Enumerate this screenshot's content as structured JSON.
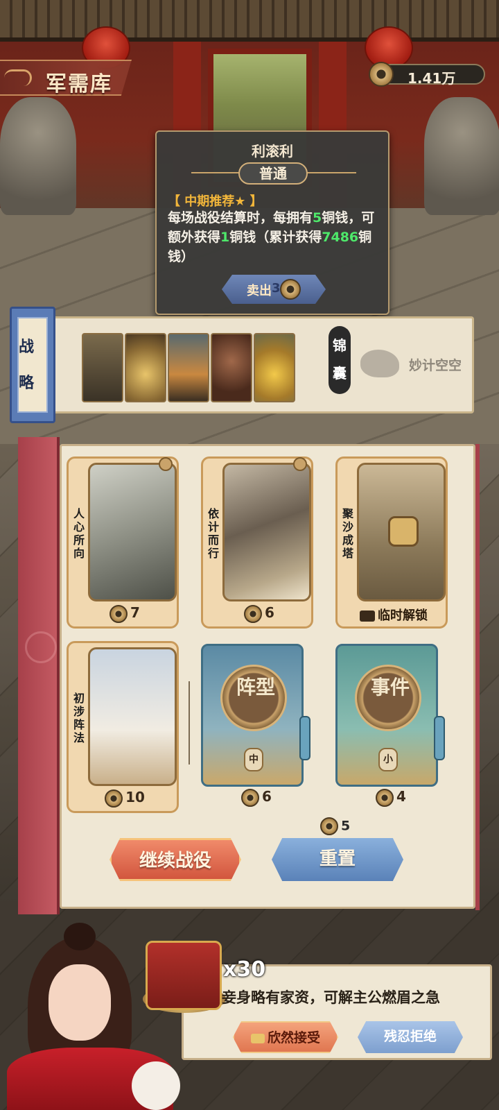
{
  "header": {
    "title": "军需库",
    "coins": "1.41万"
  },
  "tooltip": {
    "name": "利滚利",
    "rarity": "普通",
    "tag": "【 中期推荐★ 】",
    "desc_parts": [
      "每场战役结算时，每拥有",
      "5",
      "铜钱，可额外获得",
      "1",
      "铜钱（累计获得",
      "7486",
      "铜钱）"
    ],
    "sell_label": "卖出",
    "sell_price": "3"
  },
  "strategy": {
    "tag_label": "战略",
    "kit_label": "锦囊",
    "empty_text": "妙计空空"
  },
  "shop": {
    "cards": [
      {
        "title": "人心所向",
        "price": "7"
      },
      {
        "title": "依计而行",
        "price": "6"
      },
      {
        "title": "聚沙成塔",
        "unlock": "临时解锁"
      },
      {
        "title": "初涉阵法",
        "price": "10"
      }
    ],
    "books": [
      {
        "seal": "阵型",
        "size": "中",
        "price": "6"
      },
      {
        "seal": "事件",
        "size": "小",
        "price": "4"
      }
    ],
    "reset_cost": "5",
    "continue_label": "继续战役",
    "reset_label": "重置"
  },
  "offer": {
    "multiplier": "x30",
    "text": "妾身略有家资，可解主公燃眉之急",
    "accept_label": "欣然接受",
    "reject_label": "残忍拒绝"
  }
}
